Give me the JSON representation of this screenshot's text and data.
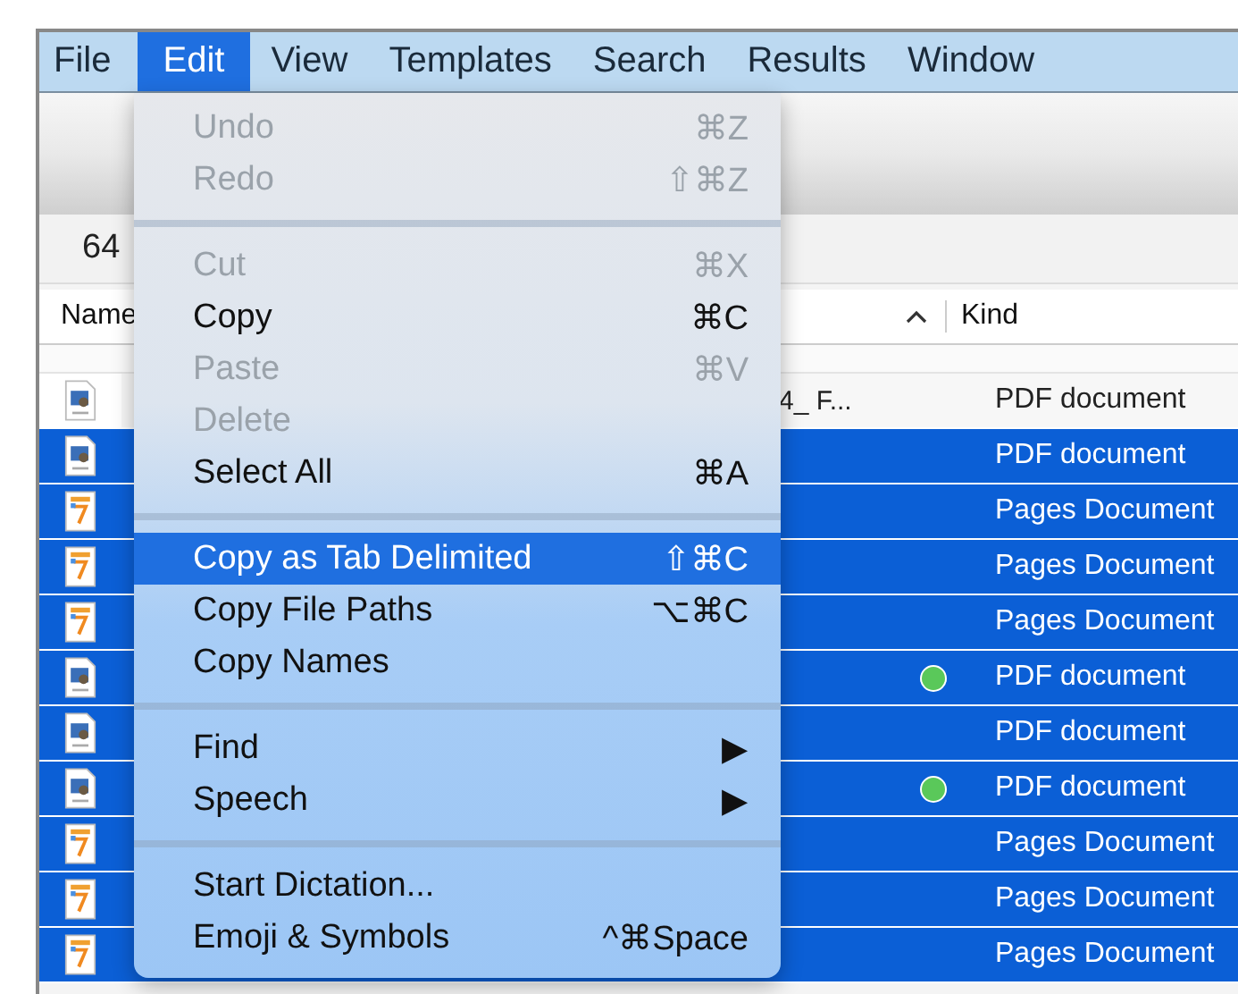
{
  "menu_bar": [
    {
      "label": "File",
      "selected": false
    },
    {
      "label": "Edit",
      "selected": true
    },
    {
      "label": "View",
      "selected": false
    },
    {
      "label": "Templates",
      "selected": false
    },
    {
      "label": "Search",
      "selected": false
    },
    {
      "label": "Results",
      "selected": false
    },
    {
      "label": "Window",
      "selected": false
    }
  ],
  "result_count": "64",
  "table": {
    "columns": [
      "Name",
      "Kind"
    ],
    "rows": [
      {
        "kind": "pdf",
        "name": "4_ F...",
        "kind_label": "PDF document",
        "selected": false
      },
      {
        "kind": "pdf",
        "kind_label": "PDF document",
        "selected": true
      },
      {
        "kind": "pages",
        "kind_label": "Pages Document",
        "selected": true
      },
      {
        "kind": "pages",
        "kind_label": "Pages Document",
        "selected": true
      },
      {
        "kind": "pages",
        "kind_label": "Pages Document",
        "selected": true
      },
      {
        "kind": "pdf",
        "kind_label": "PDF document",
        "selected": true,
        "color": "#5ac85a"
      },
      {
        "kind": "pdf",
        "kind_label": "PDF document",
        "selected": true
      },
      {
        "kind": "pdf",
        "kind_label": "PDF document",
        "selected": true,
        "color": "#5ac85a"
      },
      {
        "kind": "pages",
        "kind_label": "Pages Document",
        "selected": true
      },
      {
        "kind": "pages",
        "kind_label": "Pages Document",
        "selected": true
      },
      {
        "kind": "pages",
        "kind_label": "Pages Document",
        "selected": true
      }
    ]
  },
  "edit_menu": [
    {
      "kind": "item",
      "label": "Undo",
      "shortcut": "⌘Z",
      "disabled": true,
      "selected": false
    },
    {
      "kind": "item",
      "label": "Redo",
      "shortcut": "⇧⌘Z",
      "disabled": true,
      "selected": false
    },
    {
      "kind": "separator"
    },
    {
      "kind": "item",
      "label": "Cut",
      "shortcut": "⌘X",
      "disabled": true,
      "selected": false
    },
    {
      "kind": "item",
      "label": "Copy",
      "shortcut": "⌘C",
      "disabled": false,
      "selected": false
    },
    {
      "kind": "item",
      "label": "Paste",
      "shortcut": "⌘V",
      "disabled": true,
      "selected": false
    },
    {
      "kind": "item",
      "label": "Delete",
      "disabled": true,
      "selected": false
    },
    {
      "kind": "item",
      "label": "Select All",
      "shortcut": "⌘A",
      "disabled": false,
      "selected": false
    },
    {
      "kind": "separator"
    },
    {
      "kind": "item",
      "label": "Copy as Tab Delimited",
      "shortcut": "⇧⌘C",
      "disabled": false,
      "selected": true
    },
    {
      "kind": "item",
      "label": "Copy File Paths",
      "shortcut": "⌥⌘C",
      "disabled": false,
      "selected": false
    },
    {
      "kind": "item",
      "label": "Copy Names",
      "disabled": false,
      "selected": false
    },
    {
      "kind": "separator"
    },
    {
      "kind": "item",
      "label": "Find",
      "shortcut": "▶",
      "disabled": false,
      "selected": false
    },
    {
      "kind": "item",
      "label": "Speech",
      "shortcut": "▶",
      "disabled": false,
      "selected": false
    },
    {
      "kind": "separator"
    },
    {
      "kind": "item",
      "label": "Start Dictation...",
      "disabled": false,
      "selected": false
    },
    {
      "kind": "item",
      "label": "Emoji & Symbols",
      "shortcut": "^⌘Space",
      "disabled": false,
      "selected": false
    }
  ]
}
